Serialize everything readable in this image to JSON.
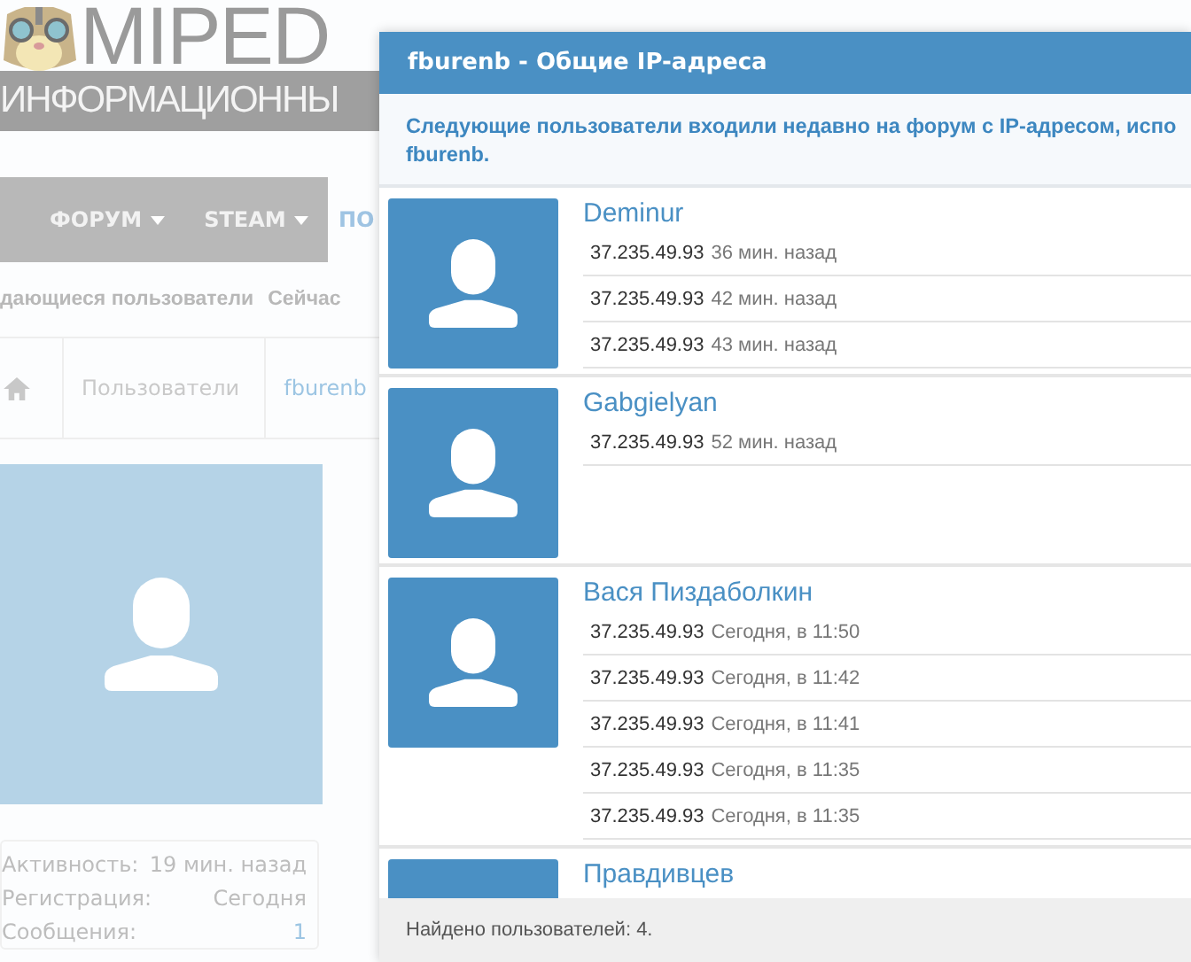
{
  "site": {
    "logo": "MIPED",
    "tagline": "ИНФОРМАЦИОННЫ"
  },
  "nav": [
    {
      "label": "ФОРУМ",
      "kind": "menu"
    },
    {
      "label": "STEAM",
      "kind": "menu"
    },
    {
      "label": "ПО",
      "kind": "link"
    }
  ],
  "subnav": [
    "дающиеся пользователи",
    "Сейчас"
  ],
  "breadcrumbs": [
    "Пользователи",
    "fburenb"
  ],
  "profile_stats": [
    {
      "label": "Активность:",
      "value": "19 мин. назад",
      "kind": "text"
    },
    {
      "label": "Регистрация:",
      "value": "Сегодня",
      "kind": "text"
    },
    {
      "label": "Сообщения:",
      "value": "1",
      "kind": "link"
    }
  ],
  "dialog": {
    "title": "fburenb - Общие IP-адреса",
    "intro_lines": [
      "Следующие пользователи входили недавно на форум с IP-адресом, испо",
      "fburenb."
    ],
    "users": [
      {
        "name": "Deminur",
        "entries": [
          {
            "ip": "37.235.49.93",
            "time": "36 мин. назад"
          },
          {
            "ip": "37.235.49.93",
            "time": "42 мин. назад"
          },
          {
            "ip": "37.235.49.93",
            "time": "43 мин. назад"
          }
        ]
      },
      {
        "name": "Gabgielyan",
        "entries": [
          {
            "ip": "37.235.49.93",
            "time": "52 мин. назад"
          }
        ]
      },
      {
        "name": "Вася Пиздаболкин",
        "entries": [
          {
            "ip": "37.235.49.93",
            "time": "Сегодня, в 11:50"
          },
          {
            "ip": "37.235.49.93",
            "time": "Сегодня, в 11:42"
          },
          {
            "ip": "37.235.49.93",
            "time": "Сегодня, в 11:41"
          },
          {
            "ip": "37.235.49.93",
            "time": "Сегодня, в 11:35"
          },
          {
            "ip": "37.235.49.93",
            "time": "Сегодня, в 11:35"
          }
        ]
      },
      {
        "name": "Правдивцев"
      }
    ],
    "footer": "Найдено пользователей: 4."
  }
}
